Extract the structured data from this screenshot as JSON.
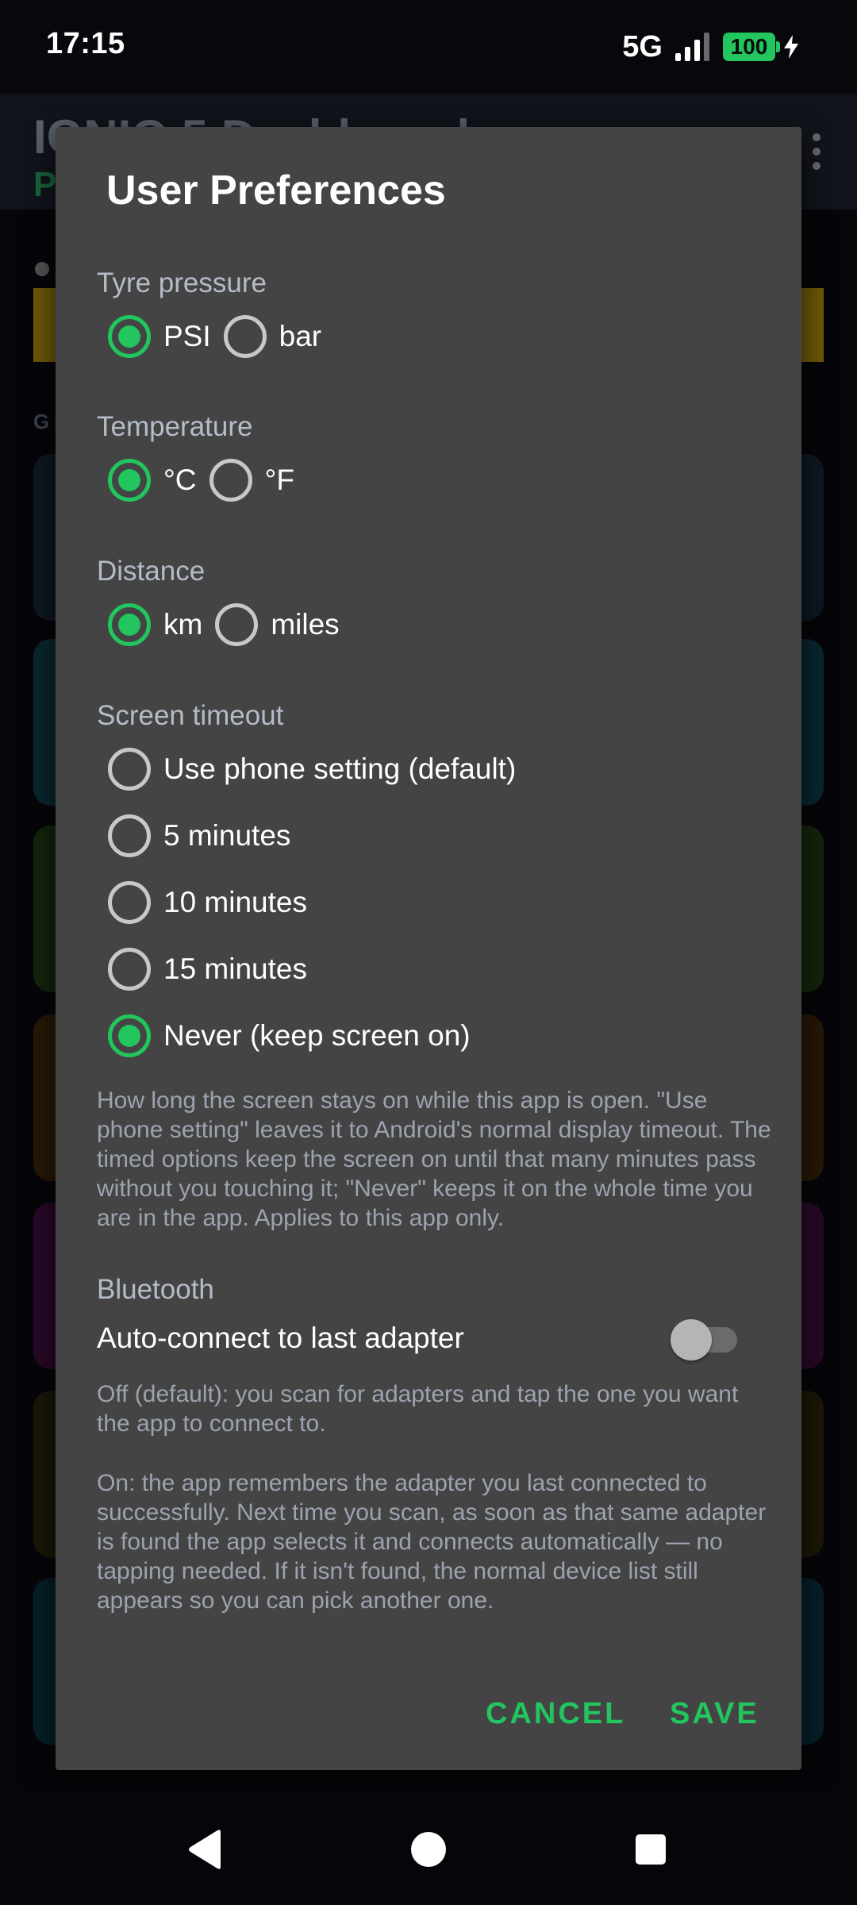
{
  "status_bar": {
    "time": "17:15",
    "network": "5G",
    "battery": "100",
    "icons": [
      "signal-icon",
      "battery-icon",
      "charging-bolt-icon"
    ]
  },
  "background_app": {
    "title": "IONIQ 5 Dashboard",
    "subtitle": "P",
    "section_label": "G"
  },
  "dialog": {
    "title": "User Preferences",
    "tyre_pressure": {
      "label": "Tyre pressure",
      "options": [
        {
          "label": "PSI",
          "checked": true
        },
        {
          "label": "bar",
          "checked": false
        }
      ]
    },
    "temperature": {
      "label": "Temperature",
      "options": [
        {
          "label": "°C",
          "checked": true
        },
        {
          "label": "°F",
          "checked": false
        }
      ]
    },
    "distance": {
      "label": "Distance",
      "options": [
        {
          "label": "km",
          "checked": true
        },
        {
          "label": "miles",
          "checked": false
        }
      ]
    },
    "screen_timeout": {
      "label": "Screen timeout",
      "options": [
        {
          "label": "Use phone setting (default)",
          "checked": false
        },
        {
          "label": "5 minutes",
          "checked": false
        },
        {
          "label": "10 minutes",
          "checked": false
        },
        {
          "label": "15 minutes",
          "checked": false
        },
        {
          "label": "Never (keep screen on)",
          "checked": true
        }
      ],
      "help": "How long the screen stays on while this app is open. \"Use phone setting\" leaves it to Android's normal display timeout. The timed options keep the screen on until that many minutes pass without you touching it; \"Never\" keeps it on the whole time you are in the app. Applies to this app only."
    },
    "bluetooth": {
      "label": "Bluetooth",
      "toggle_label": "Auto-connect to last adapter",
      "toggle_on": false,
      "help_off": "Off (default): you scan for adapters and tap the one you want the app to connect to.",
      "help_on": "On: the app remembers the adapter you last connected to successfully. Next time you scan, as soon as that same adapter is found the app selects it and connects automatically — no tapping needed. If it isn't found, the normal device list still appears so you can pick another one."
    },
    "buttons": {
      "cancel": "CANCEL",
      "save": "SAVE"
    }
  },
  "colors": {
    "accent": "#22c55e",
    "dialog_bg": "#444444",
    "secondary_text": "#9ca3af"
  },
  "nav_bar": {
    "icons": [
      "back-icon",
      "home-icon",
      "recents-icon"
    ]
  }
}
